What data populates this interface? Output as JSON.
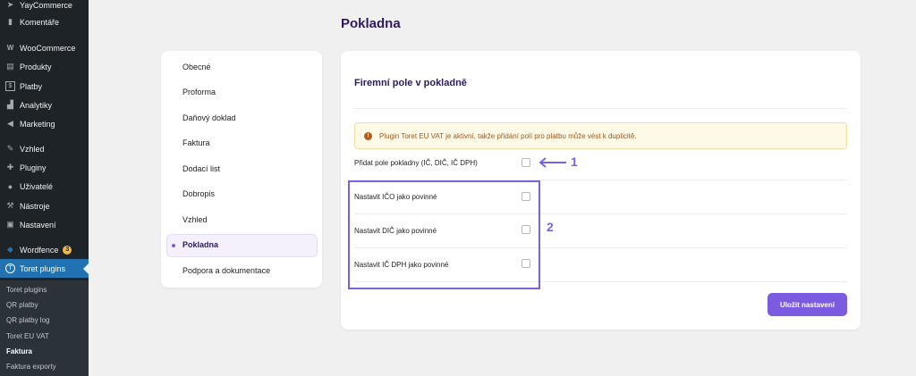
{
  "sidebar": {
    "items": [
      {
        "label": "YayCommerce",
        "icon": "paper-plane-icon"
      },
      {
        "label": "Komentáře",
        "icon": "comment-icon"
      },
      {
        "label": "WooCommerce",
        "icon": "woo-icon"
      },
      {
        "label": "Produkty",
        "icon": "archive-icon"
      },
      {
        "label": "Platby",
        "icon": "dollar-icon"
      },
      {
        "label": "Analytiky",
        "icon": "bar-chart-icon"
      },
      {
        "label": "Marketing",
        "icon": "megaphone-icon"
      },
      {
        "label": "Vzhled",
        "icon": "brush-icon"
      },
      {
        "label": "Pluginy",
        "icon": "plugin-icon"
      },
      {
        "label": "Uživatelé",
        "icon": "user-icon"
      },
      {
        "label": "Nástroje",
        "icon": "wrench-icon"
      },
      {
        "label": "Nastavení",
        "icon": "settings-icon"
      },
      {
        "label": "Wordfence",
        "icon": "wordfence-icon",
        "badge": "3"
      },
      {
        "label": "Toret plugins",
        "icon": "toret-icon"
      }
    ],
    "submenu": [
      "Toret plugins",
      "QR platby",
      "QR platby log",
      "Toret EU VAT",
      "Faktura",
      "Faktura exporty"
    ]
  },
  "page": {
    "title": "Pokladna"
  },
  "nav": {
    "items": [
      "Obecné",
      "Proforma",
      "Daňový doklad",
      "Faktura",
      "Dodací list",
      "Dobropis",
      "Vzhled",
      "Pokladna",
      "Podpora a dokumentace"
    ],
    "active": "Pokladna"
  },
  "settings": {
    "section_title": "Firemní pole v pokladně",
    "notice": "Plugin Toret EU VAT je aktivní, takže přidání polí pro platbu může vést k duplicitě.",
    "rows": [
      {
        "label": "Přidat pole pokladny (IČ, DIČ, IČ DPH)",
        "checked": false
      },
      {
        "label": "Nastavit IČO jako povinné",
        "checked": false
      },
      {
        "label": "Nastavit DIČ jako povinné",
        "checked": false
      },
      {
        "label": "Nastavit IČ DPH jako povinné",
        "checked": false
      }
    ],
    "save_label": "Uložit nastavení"
  },
  "annotations": {
    "one": "1",
    "two": "2"
  },
  "colors": {
    "accent": "#7b5ce0",
    "annotation": "#7564e0",
    "wp_active": "#2271b1",
    "title": "#2e1a5c"
  }
}
